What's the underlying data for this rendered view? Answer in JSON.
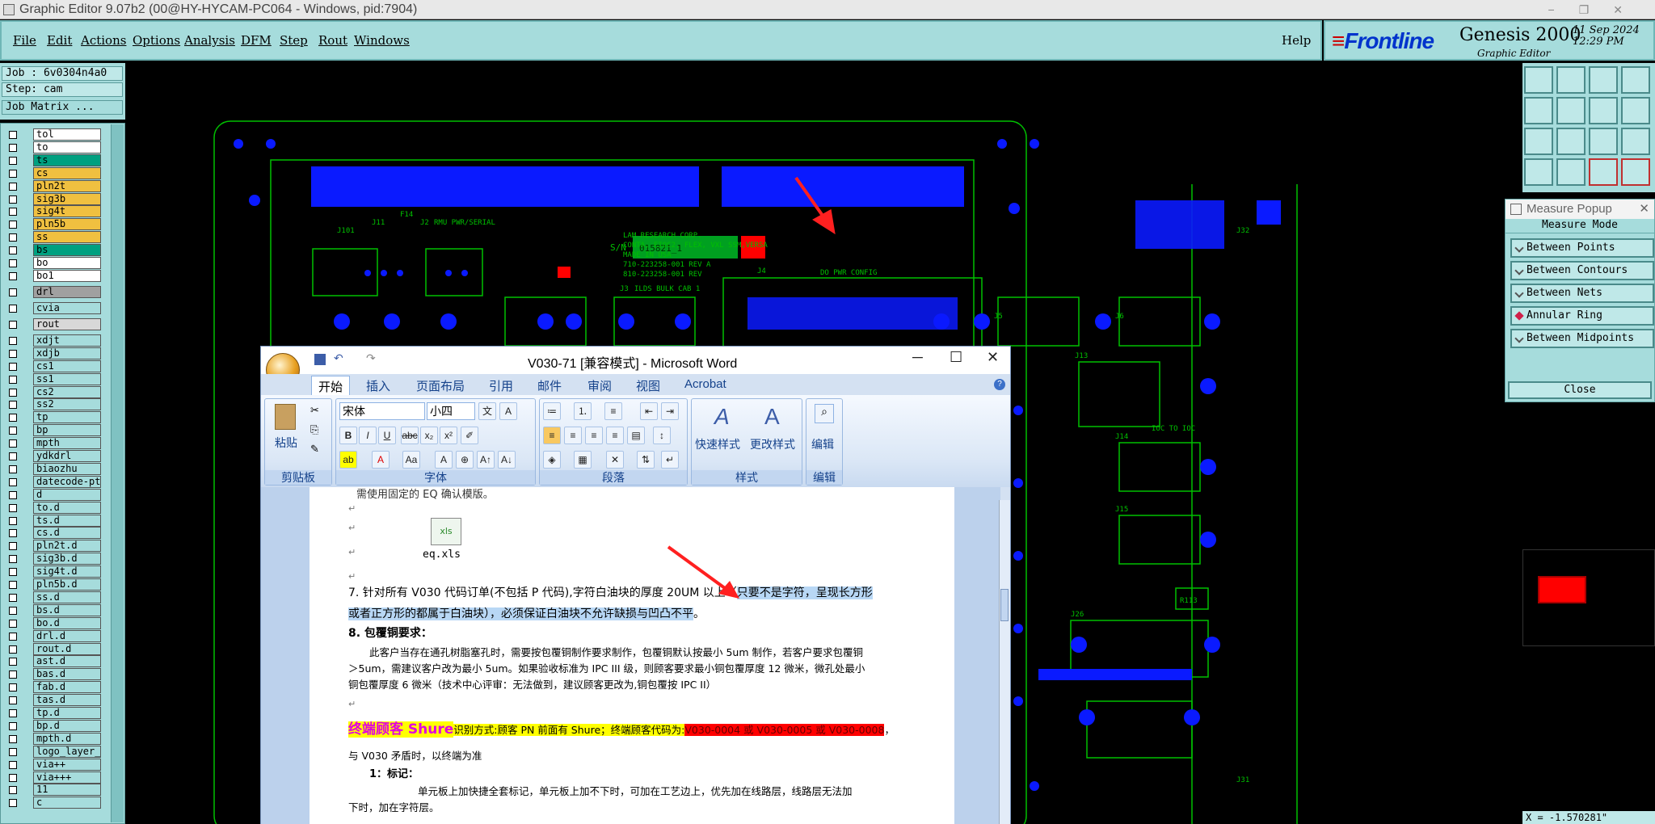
{
  "window": {
    "title": "Graphic Editor 9.07b2 (00@HY-HYCAM-PC064 - Windows, pid:7904)"
  },
  "menu": [
    "File",
    "Edit",
    "Actions",
    "Options",
    "Analysis",
    "DFM",
    "Step",
    "Rout",
    "Windows"
  ],
  "help": "Help",
  "brand": {
    "logo": "Frontline",
    "product": "Genesis 2000",
    "sub": "Graphic Editor",
    "date": "11 Sep 2024",
    "time": "12:29 PM"
  },
  "info": {
    "job": "Job : 6v0304n4a0",
    "step": "Step: cam",
    "matrix": "Job Matrix ..."
  },
  "layers": [
    {
      "name": "tol",
      "color": "#ffffff"
    },
    {
      "name": "to",
      "color": "#ffffff"
    },
    {
      "name": "ts",
      "color": "#00a080"
    },
    {
      "name": "cs",
      "color": "#f0c040"
    },
    {
      "name": "pln2t",
      "color": "#f0c040"
    },
    {
      "name": "sig3b",
      "color": "#f0c040"
    },
    {
      "name": "sig4t",
      "color": "#f0c040"
    },
    {
      "name": "pln5b",
      "color": "#f0c040"
    },
    {
      "name": "ss",
      "color": "#f0c040"
    },
    {
      "name": "bs",
      "color": "#00a080"
    },
    {
      "name": "bo",
      "color": "#ffffff"
    },
    {
      "name": "bo1",
      "color": "#ffffff"
    },
    {
      "name": "drl",
      "color": "#a0a0a0"
    },
    {
      "name": "cvia",
      "color": "#a6dcdc"
    },
    {
      "name": "rout",
      "color": "#d8d8d8"
    },
    {
      "name": "xdjt",
      "color": "#a6dcdc"
    },
    {
      "name": "xdjb",
      "color": "#a6dcdc"
    },
    {
      "name": "cs1",
      "color": "#a6dcdc"
    },
    {
      "name": "ss1",
      "color": "#a6dcdc"
    },
    {
      "name": "cs2",
      "color": "#a6dcdc"
    },
    {
      "name": "ss2",
      "color": "#a6dcdc"
    },
    {
      "name": "tp",
      "color": "#a6dcdc"
    },
    {
      "name": "bp",
      "color": "#a6dcdc"
    },
    {
      "name": "mpth",
      "color": "#a6dcdc"
    },
    {
      "name": "ydkdrl",
      "color": "#a6dcdc"
    },
    {
      "name": "biaozhu",
      "color": "#a6dcdc"
    },
    {
      "name": "datecode-pt",
      "color": "#a6dcdc"
    },
    {
      "name": "d",
      "color": "#a6dcdc"
    },
    {
      "name": "to.d",
      "color": "#a6dcdc"
    },
    {
      "name": "ts.d",
      "color": "#a6dcdc"
    },
    {
      "name": "cs.d",
      "color": "#a6dcdc"
    },
    {
      "name": "pln2t.d",
      "color": "#a6dcdc"
    },
    {
      "name": "sig3b.d",
      "color": "#a6dcdc"
    },
    {
      "name": "sig4t.d",
      "color": "#a6dcdc"
    },
    {
      "name": "pln5b.d",
      "color": "#a6dcdc"
    },
    {
      "name": "ss.d",
      "color": "#a6dcdc"
    },
    {
      "name": "bs.d",
      "color": "#a6dcdc"
    },
    {
      "name": "bo.d",
      "color": "#a6dcdc"
    },
    {
      "name": "drl.d",
      "color": "#a6dcdc"
    },
    {
      "name": "rout.d",
      "color": "#a6dcdc"
    },
    {
      "name": "ast.d",
      "color": "#a6dcdc"
    },
    {
      "name": "bas.d",
      "color": "#a6dcdc"
    },
    {
      "name": "fab.d",
      "color": "#a6dcdc"
    },
    {
      "name": "tas.d",
      "color": "#a6dcdc"
    },
    {
      "name": "tp.d",
      "color": "#a6dcdc"
    },
    {
      "name": "bp.d",
      "color": "#a6dcdc"
    },
    {
      "name": "mpth.d",
      "color": "#a6dcdc"
    },
    {
      "name": "logo_layer_",
      "color": "#a6dcdc"
    },
    {
      "name": "via++",
      "color": "#a6dcdc"
    },
    {
      "name": "via+++",
      "color": "#a6dcdc"
    },
    {
      "name": "11",
      "color": "#a6dcdc"
    },
    {
      "name": "c",
      "color": "#a6dcdc"
    }
  ],
  "measure": {
    "title": "Measure Popup",
    "mode": "Measure Mode",
    "options": [
      "Between Points",
      "Between Contours",
      "Between Nets",
      "Annular Ring",
      "Between Midpoints"
    ],
    "selected": 3,
    "close": "Close"
  },
  "coord": "X = -1.570281\"",
  "pcb": {
    "sn_label": "S/N",
    "sn_value": "015821_1",
    "labels": [
      "J101",
      "J11",
      "J2",
      "F14",
      "RMU PWR/SERIAL",
      "LAM RESEARCH CORP.",
      "CONTA, EIOC2, FLEX, VXL SSM,VERSA",
      "MADE IN USA",
      "710-223258-001 REV A",
      "810-223258-001 REV",
      "ILDS BULK CAB 1",
      "J3",
      "J4",
      "DO PWR CONFIG",
      "IOC TO IOC",
      "J32",
      "J31",
      "J5",
      "J6",
      "J13",
      "J14",
      "J15",
      "J26",
      "R113"
    ]
  },
  "word": {
    "title": "V030-71 [兼容模式] - Microsoft Word",
    "tabs": [
      "开始",
      "插入",
      "页面布局",
      "引用",
      "邮件",
      "审阅",
      "视图",
      "Acrobat"
    ],
    "groups": [
      "剪贴板",
      "字体",
      "段落",
      "样式",
      "编辑"
    ],
    "paste": "粘贴",
    "font": "宋体",
    "size": "小四",
    "styles": [
      "快速样式",
      "更改样式"
    ],
    "edit": "编辑",
    "attachment": "eq.xls",
    "lines": {
      "l0": "需使用固定的 EQ 确认模版。",
      "p7a": "7. 针对所有 V030 代码订单(不包括 P 代码),字符白油块的厚度 20UM 以上（",
      "p7b": "只要不是字符，呈现长方形",
      "p7c": "或者正方形的都属于白油块），必须保证白油块不允许缺损与凹凸不平",
      "p7d": "。",
      "h8": "8. 包覆铜要求：",
      "p8a": "此客户当存在通孔树脂塞孔时，需要按包覆铜制作要求制作，包覆铜默认按最小 5um 制作，若客户要求包覆铜",
      "p8b": "＞5um，需建议客户改为最小 5um。如果验收标准为 IPC III 级，则顾客要求最小铜包覆厚度 12 微米，微孔处最小",
      "p8c": "铜包覆厚度 6 微米（技术中心评审：无法做到，建议顾客更改为,铜包覆按 IPC II）",
      "shure": "终端顾客 Shure",
      "shure2": "识别方式:顾客 PN 前面有 Shure；终端顾客代码为:",
      "shure3": "V030-0004 或 V030-0005 或 V030-0008",
      "shure4": "，",
      "l9": "与 V030 矛盾时，以终端为准",
      "h1": "1：标记：",
      "p1a": "单元板上加快捷全套标记，单元板上加不下时，可加在工艺边上，优先加在线路层，线路层无法加",
      "p1b": "下时，加在字符层。"
    }
  }
}
